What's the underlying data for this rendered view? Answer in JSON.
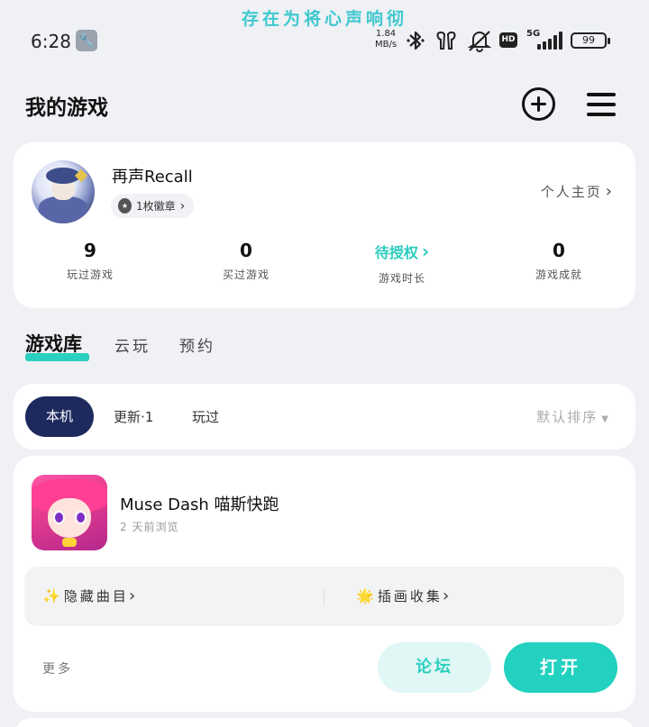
{
  "banner": "存在为将心声响彻",
  "status_bar": {
    "time": "6:28",
    "net_speed_value": "1.84",
    "net_speed_unit": "MB/s",
    "network": "5G",
    "hd": "HD",
    "battery": "99",
    "icons": [
      "wrench-icon",
      "bluetooth-icon",
      "earbuds-icon",
      "bell-off-icon",
      "hd-icon",
      "signal-icon",
      "battery-icon"
    ]
  },
  "header": {
    "title": "我的游戏"
  },
  "profile": {
    "username": "再声Recall",
    "medal_label": "1枚徽章",
    "homepage_label": "个人主页",
    "stats": [
      {
        "value": "9",
        "label": "玩过游戏"
      },
      {
        "value": "0",
        "label": "买过游戏"
      },
      {
        "value": "待授权",
        "label": "游戏时长"
      },
      {
        "value": "0",
        "label": "游戏成就"
      }
    ]
  },
  "library_tabs": [
    "游戏库",
    "云玩",
    "预约"
  ],
  "filters": {
    "options": [
      "本机",
      "更新·1",
      "玩过"
    ],
    "sort_label": "默认排序"
  },
  "game": {
    "name": "Muse Dash 喵斯快跑",
    "subtitle": "2 天前浏览",
    "features": [
      {
        "emoji": "✨",
        "label": "隐藏曲目"
      },
      {
        "emoji": "🌟",
        "label": "插画收集"
      }
    ],
    "more_label": "更多",
    "forum_label": "论坛",
    "open_label": "打开"
  },
  "colors": {
    "accent": "#22d1bf",
    "navy": "#1e2a5e",
    "background": "#eff1f5"
  }
}
